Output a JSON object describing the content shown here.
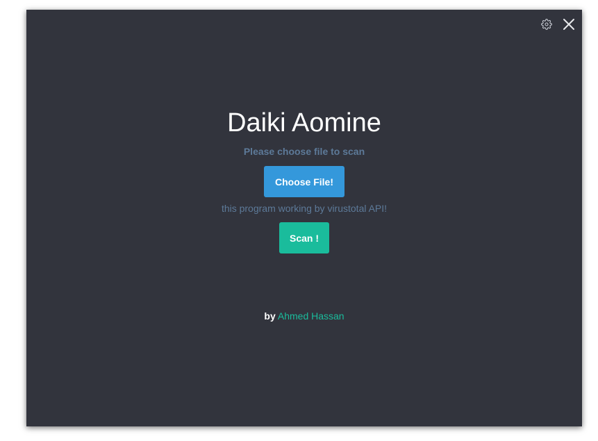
{
  "app": {
    "title": "Daiki Aomine",
    "subtitle": "Please choose file to scan",
    "choose_button_label": "Choose File!",
    "api_note": "this program working by virustotal API!",
    "scan_button_label": "Scan !",
    "credit_prefix": "by",
    "credit_author": "Ahmed Hassan"
  },
  "window_controls": {
    "settings_icon": "gear-icon",
    "close_icon": "close-icon"
  },
  "colors": {
    "background": "#32343d",
    "title": "#ffffff",
    "muted_text": "#5d7a99",
    "primary_button": "#3498db",
    "success_button": "#1abc9c",
    "author_link": "#1abc9c"
  }
}
